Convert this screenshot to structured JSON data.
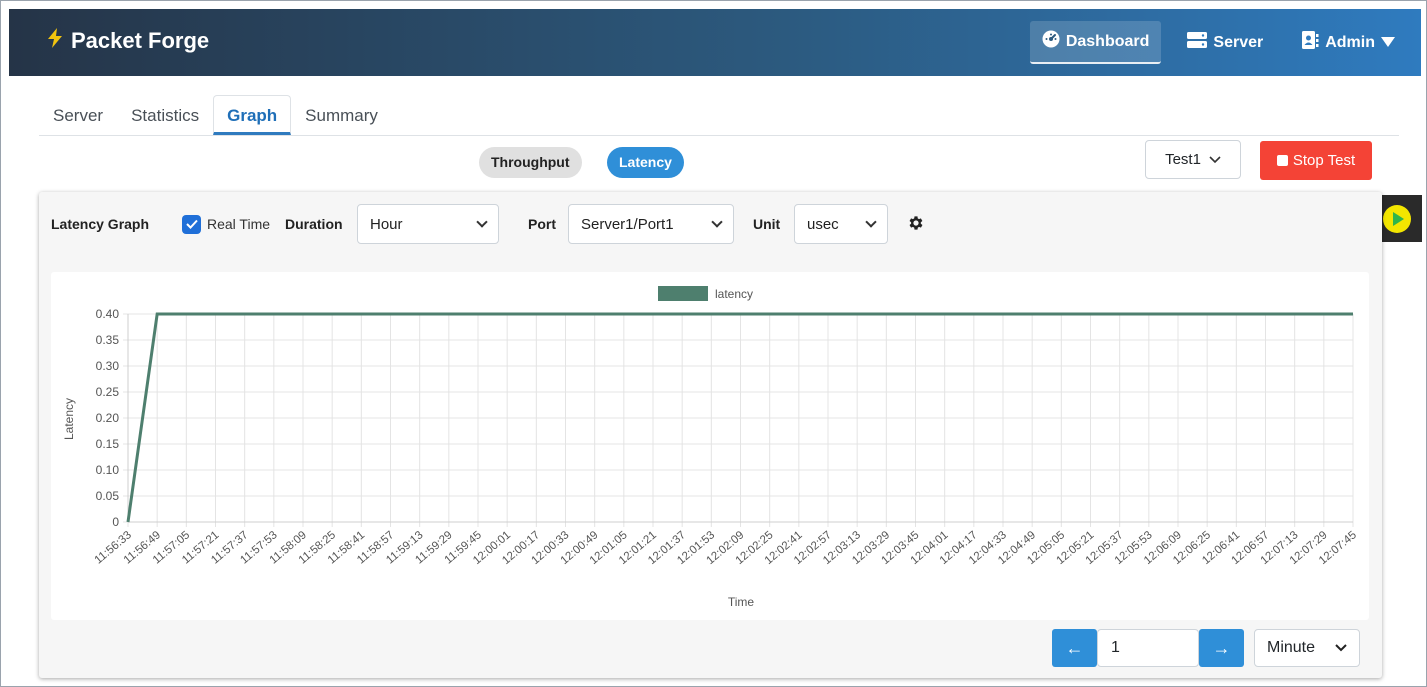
{
  "header": {
    "brand": "Packet Forge",
    "nav": {
      "dashboard": "Dashboard",
      "server": "Server",
      "admin": "Admin"
    }
  },
  "tabs": [
    {
      "label": "Server",
      "active": false
    },
    {
      "label": "Statistics",
      "active": false
    },
    {
      "label": "Graph",
      "active": true
    },
    {
      "label": "Summary",
      "active": false
    }
  ],
  "graph_type": {
    "throughput": "Throughput",
    "latency": "Latency",
    "selected": "Latency"
  },
  "test_select": {
    "value": "Test1"
  },
  "stop_button": {
    "label": "Stop Test"
  },
  "controls": {
    "title": "Latency Graph",
    "realtime": {
      "label": "Real Time",
      "checked": true
    },
    "duration": {
      "label": "Duration",
      "value": "Hour"
    },
    "port": {
      "label": "Port",
      "value": "Server1/Port1"
    },
    "unit": {
      "label": "Unit",
      "value": "usec"
    }
  },
  "pagination": {
    "prev": "←",
    "next": "→",
    "page": "1",
    "interval": "Minute"
  },
  "colors": {
    "series": "#4e7f6e",
    "accent": "#2f8fd8",
    "danger": "#f44336"
  },
  "chart_data": {
    "type": "line",
    "title": "",
    "xlabel": "Time",
    "ylabel": "Latency",
    "ylim": [
      0,
      0.4
    ],
    "yticks": [
      "0",
      "0.05",
      "0.10",
      "0.15",
      "0.20",
      "0.25",
      "0.30",
      "0.35",
      "0.40"
    ],
    "legend": "top-center",
    "grid": true,
    "categories": [
      "11:56:33",
      "11:56:49",
      "11:57:05",
      "11:57:21",
      "11:57:37",
      "11:57:53",
      "11:58:09",
      "11:58:25",
      "11:58:41",
      "11:58:57",
      "11:59:13",
      "11:59:29",
      "11:59:45",
      "12:00:01",
      "12:00:17",
      "12:00:33",
      "12:00:49",
      "12:01:05",
      "12:01:21",
      "12:01:37",
      "12:01:53",
      "12:02:09",
      "12:02:25",
      "12:02:41",
      "12:02:57",
      "12:03:13",
      "12:03:29",
      "12:03:45",
      "12:04:01",
      "12:04:17",
      "12:04:33",
      "12:04:49",
      "12:05:05",
      "12:05:21",
      "12:05:37",
      "12:05:53",
      "12:06:09",
      "12:06:25",
      "12:06:41",
      "12:06:57",
      "12:07:13",
      "12:07:29",
      "12:07:45"
    ],
    "series": [
      {
        "name": "latency",
        "values": [
          0,
          0.4,
          0.4,
          0.4,
          0.4,
          0.4,
          0.4,
          0.4,
          0.4,
          0.4,
          0.4,
          0.4,
          0.4,
          0.4,
          0.4,
          0.4,
          0.4,
          0.4,
          0.4,
          0.4,
          0.4,
          0.4,
          0.4,
          0.4,
          0.4,
          0.4,
          0.4,
          0.4,
          0.4,
          0.4,
          0.4,
          0.4,
          0.4,
          0.4,
          0.4,
          0.4,
          0.4,
          0.4,
          0.4,
          0.4,
          0.4,
          0.4,
          0.4
        ]
      }
    ]
  }
}
